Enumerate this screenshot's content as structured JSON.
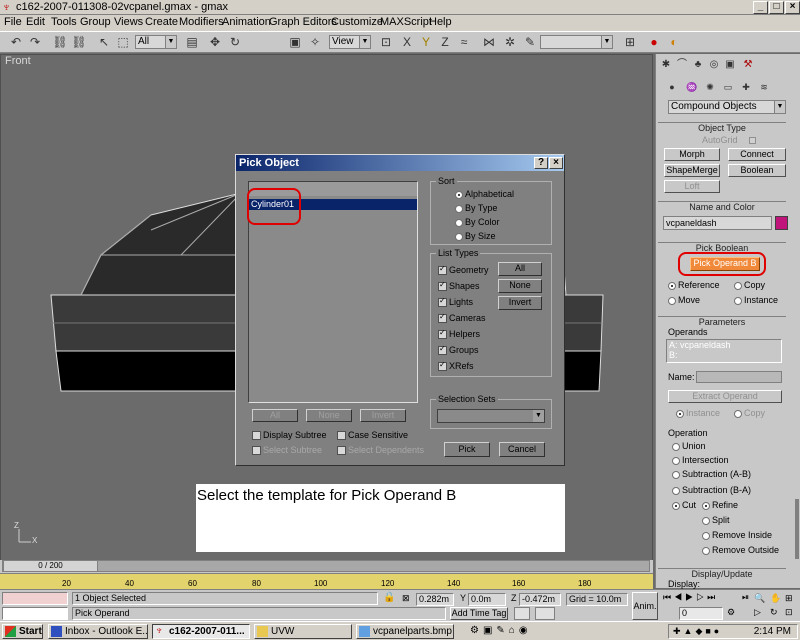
{
  "window": {
    "title": "c162-2007-011308-02vcpanel.gmax - gmax",
    "controls": [
      "_",
      "□",
      "×"
    ]
  },
  "menu": [
    "File",
    "Edit",
    "Tools",
    "Group",
    "Views",
    "Create",
    "Modifiers",
    "Animation",
    "Graph Editors",
    "Customize",
    "MAXScript",
    "Help"
  ],
  "toolbar": {
    "selection_filter": "All",
    "coord_system": "View"
  },
  "viewport": {
    "label": "Front",
    "axis_x": "X",
    "axis_z": "Z"
  },
  "command_panel": {
    "category_dropdown": "Compound Objects",
    "object_type": {
      "title": "Object Type",
      "autogrid": "AutoGrid",
      "buttons": [
        "Morph",
        "Connect",
        "ShapeMerge",
        "Boolean",
        "Loft"
      ]
    },
    "name_color": {
      "title": "Name and Color",
      "name_value": "vcpaneldash",
      "swatch_color": "#c0147a"
    },
    "pick_boolean": {
      "title": "Pick Boolean",
      "pick_button": "Pick Operand B",
      "options": [
        "Reference",
        "Copy",
        "Move",
        "Instance"
      ]
    },
    "parameters": {
      "title": "Parameters",
      "operands_label": "Operands",
      "operands": [
        "A: vcpaneldash",
        "B:"
      ],
      "name_label": "Name:",
      "extract_button": "Extract Operand",
      "extract_options": [
        "Instance",
        "Copy"
      ],
      "operation_label": "Operation",
      "operations": [
        "Union",
        "Intersection",
        "Subtraction (A-B)",
        "Subtraction (B-A)",
        "Cut"
      ],
      "cut_options": [
        "Refine",
        "Split",
        "Remove Inside",
        "Remove Outside"
      ]
    },
    "display_update": {
      "title": "Display/Update",
      "display_label": "Display:"
    }
  },
  "dialog": {
    "title": "Pick Object",
    "help": "?",
    "close": "×",
    "list_items": [
      "Cylinder01"
    ],
    "sort": {
      "title": "Sort",
      "options": [
        "Alphabetical",
        "By Type",
        "By Color",
        "By Size"
      ]
    },
    "list_types": {
      "title": "List Types",
      "items": [
        "Geometry",
        "Shapes",
        "Lights",
        "Cameras",
        "Helpers",
        "Groups",
        "XRefs"
      ],
      "buttons": [
        "All",
        "None",
        "Invert"
      ]
    },
    "list_buttons": [
      "All",
      "None",
      "Invert"
    ],
    "checkboxes": [
      "Display Subtree",
      "Case Sensitive",
      "Select Subtree",
      "Select Dependents"
    ],
    "selection_sets": {
      "title": "Selection Sets"
    },
    "pick_button": "Pick",
    "cancel_button": "Cancel"
  },
  "caption": "Select the template for Pick Operand B",
  "timeline": {
    "frame_slider": "0 / 200",
    "ticks": [
      "20",
      "40",
      "60",
      "80",
      "100",
      "120",
      "140",
      "160",
      "180"
    ]
  },
  "status": {
    "selection": "1 Object Selected",
    "prompt": "Pick Operand",
    "x": "0.282m",
    "y": "0.0m",
    "z": "-0.472m",
    "grid": "Grid = 10.0m",
    "add_time_tag": "Add Time Tag",
    "anim": "Anim.",
    "frame": "0"
  },
  "taskbar": {
    "start": "Start",
    "tasks": [
      "Inbox - Outlook E...",
      "c162-2007-011...",
      "UVW",
      "vcpanelparts.bmp ..."
    ],
    "clock": "2:14 PM"
  }
}
